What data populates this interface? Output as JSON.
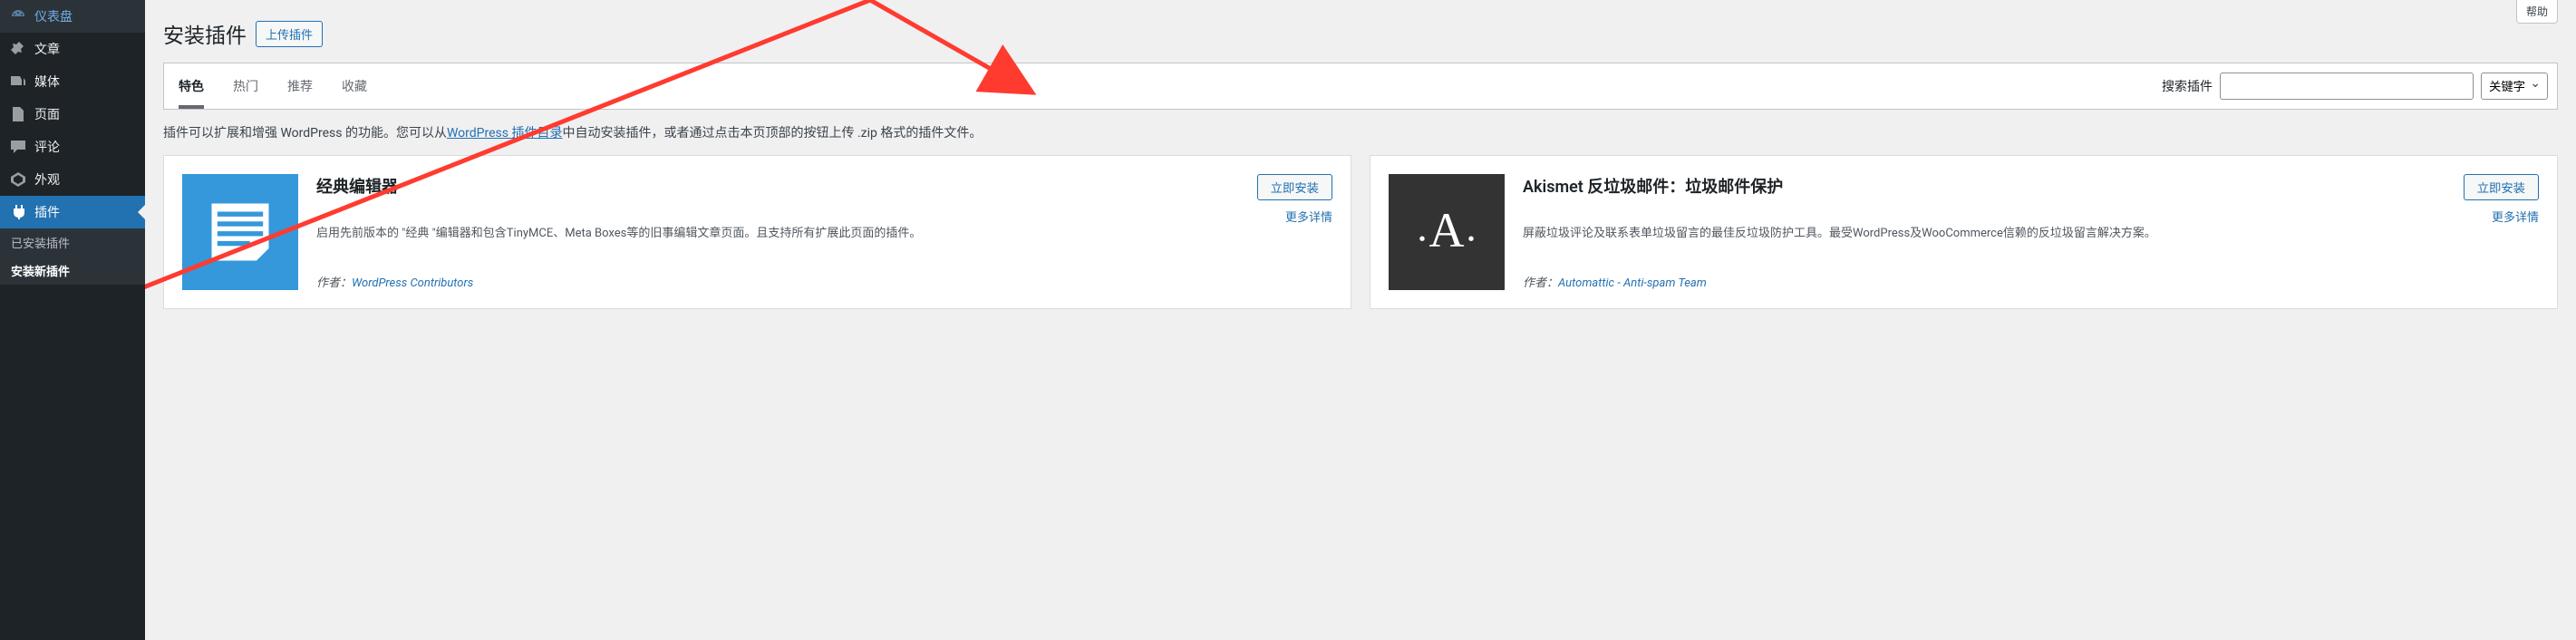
{
  "help_label": "帮助",
  "sidebar": {
    "items": [
      {
        "label": "仪表盘",
        "icon": "dashboard"
      },
      {
        "label": "文章",
        "icon": "pin"
      },
      {
        "label": "媒体",
        "icon": "media"
      },
      {
        "label": "页面",
        "icon": "page"
      },
      {
        "label": "评论",
        "icon": "comment"
      },
      {
        "label": "外观",
        "icon": "appearance"
      },
      {
        "label": "插件",
        "icon": "plugin"
      }
    ],
    "submenu": [
      {
        "label": "已安装插件"
      },
      {
        "label": "安装新插件"
      }
    ]
  },
  "header": {
    "title": "安装插件",
    "upload_label": "上传插件"
  },
  "filter": {
    "tabs": [
      "特色",
      "热门",
      "推荐",
      "收藏"
    ],
    "search_label": "搜索插件",
    "search_placeholder": "",
    "select_value": "关键字"
  },
  "description": {
    "prefix": "插件可以扩展和增强 WordPress 的功能。您可以从",
    "link": "WordPress 插件目录",
    "suffix": "中自动安装插件，或者通过点击本页顶部的按钮上传 .zip 格式的插件文件。"
  },
  "cards": [
    {
      "title": "经典编辑器",
      "desc": "启用先前版本的 \"经典 \"编辑器和包含TinyMCE、Meta Boxes等的旧事编辑文章页面。且支持所有扩展此页面的插件。",
      "install": "立即安装",
      "details": "更多详情",
      "author_label": "作者：",
      "author": "WordPress Contributors"
    },
    {
      "title": "Akismet 反垃圾邮件：垃圾邮件保护",
      "desc": "屏蔽垃圾评论及联系表单垃圾留言的最佳反垃圾防护工具。最受WordPress及WooCommerce信赖的反垃圾留言解决方案。",
      "install": "立即安装",
      "details": "更多详情",
      "author_label": "作者：",
      "author": "Automattic - Anti-spam Team"
    }
  ]
}
